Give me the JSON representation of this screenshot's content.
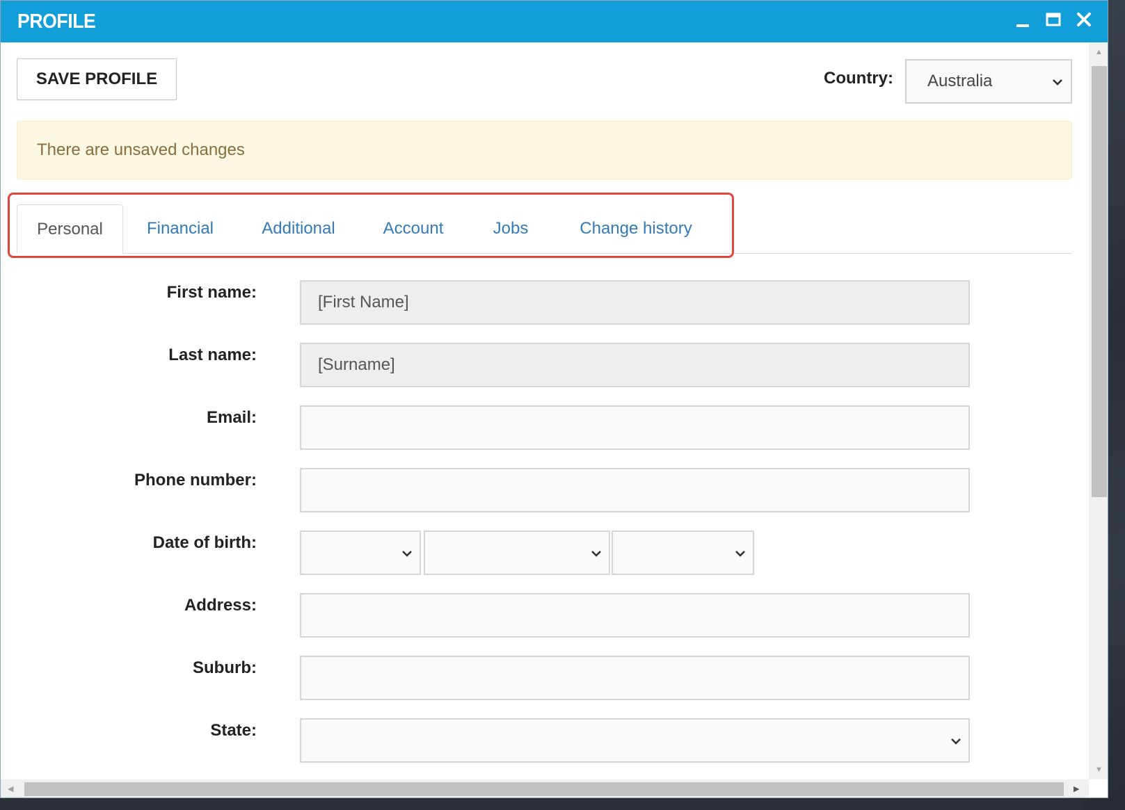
{
  "window": {
    "title": "PROFILE"
  },
  "toolbar": {
    "save_label": "SAVE PROFILE",
    "country_label": "Country:",
    "country_value": "Australia"
  },
  "alert": {
    "text": "There are unsaved changes"
  },
  "tabs": [
    {
      "label": "Personal",
      "active": true
    },
    {
      "label": "Financial"
    },
    {
      "label": "Additional"
    },
    {
      "label": "Account"
    },
    {
      "label": "Jobs"
    },
    {
      "label": "Change history"
    }
  ],
  "form": {
    "first_name": {
      "label": "First name:",
      "value": "[First Name]"
    },
    "last_name": {
      "label": "Last name:",
      "value": "[Surname]"
    },
    "email": {
      "label": "Email:",
      "value": ""
    },
    "phone": {
      "label": "Phone number:",
      "value": ""
    },
    "dob": {
      "label": "Date of birth:",
      "day": "",
      "month": "",
      "year": ""
    },
    "address": {
      "label": "Address:",
      "value": ""
    },
    "suburb": {
      "label": "Suburb:",
      "value": ""
    },
    "state": {
      "label": "State:",
      "value": ""
    }
  },
  "colors": {
    "titlebar": "#129ed9",
    "link": "#337ab7",
    "alert_bg": "#fcf8e3",
    "alert_text": "#8a6d3b",
    "highlight": "#e0473a"
  }
}
